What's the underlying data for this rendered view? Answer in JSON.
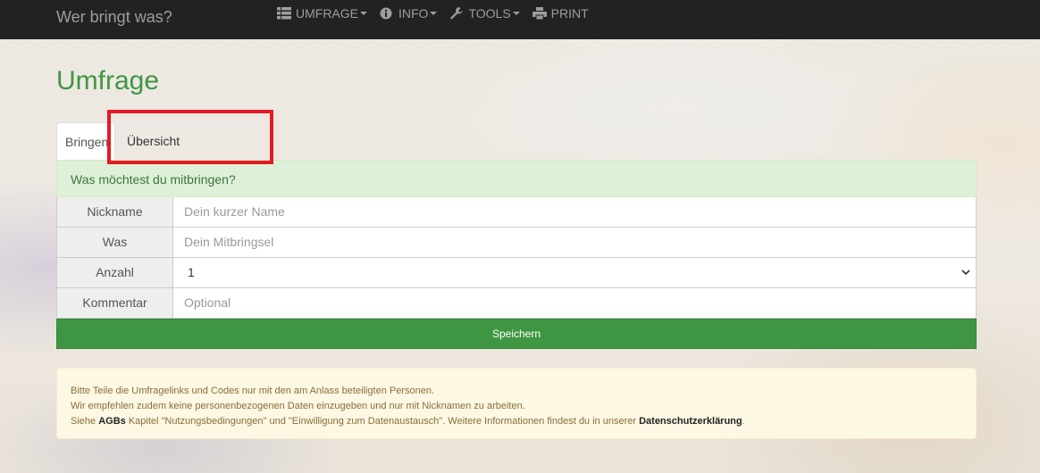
{
  "navbar": {
    "brand": "Wer bringt was?",
    "items": [
      {
        "label": "UMFRAGE",
        "icon": "list-icon",
        "dropdown": true
      },
      {
        "label": "INFO",
        "icon": "info-icon",
        "dropdown": true
      },
      {
        "label": "TOOLS",
        "icon": "wrench-icon",
        "dropdown": true
      },
      {
        "label": "PRINT",
        "icon": "print-icon",
        "dropdown": false
      }
    ]
  },
  "page": {
    "title": "Umfrage"
  },
  "tabs": [
    {
      "label": "Bringen",
      "active": true
    },
    {
      "label": "Übersicht",
      "active": false
    }
  ],
  "form": {
    "heading": "Was möchtest du mitbringen?",
    "fields": {
      "nickname": {
        "label": "Nickname",
        "placeholder": "Dein kurzer Name",
        "value": ""
      },
      "was": {
        "label": "Was",
        "placeholder": "Dein Mitbringsel",
        "value": ""
      },
      "anzahl": {
        "label": "Anzahl",
        "value": "1"
      },
      "kommentar": {
        "label": "Kommentar",
        "placeholder": "Optional",
        "value": ""
      }
    },
    "save_label": "Speichern"
  },
  "notice": {
    "line1": "Bitte Teile die Umfragelinks und Codes nur mit den am Anlass beteiligten Personen.",
    "line2": "Wir empfehlen zudem keine personenbezogenen Daten einzugeben und nur mit Nicknamen zu arbeiten.",
    "line3_pre": "Siehe ",
    "agb_link": "AGBs",
    "line3_mid": " Kapitel \"Nutzungsbedingungen\" und \"Einwilligung zum Datenaustausch\". Weitere Informationen findest du in unserer ",
    "privacy_link": "Datenschutzerklärung",
    "line3_post": "."
  },
  "colors": {
    "navbar_bg": "#222222",
    "accent_green": "#3f9642",
    "panel_heading_bg": "#dff0d8",
    "alert_bg": "#fcf8e3",
    "highlight_red": "#e31b23"
  }
}
